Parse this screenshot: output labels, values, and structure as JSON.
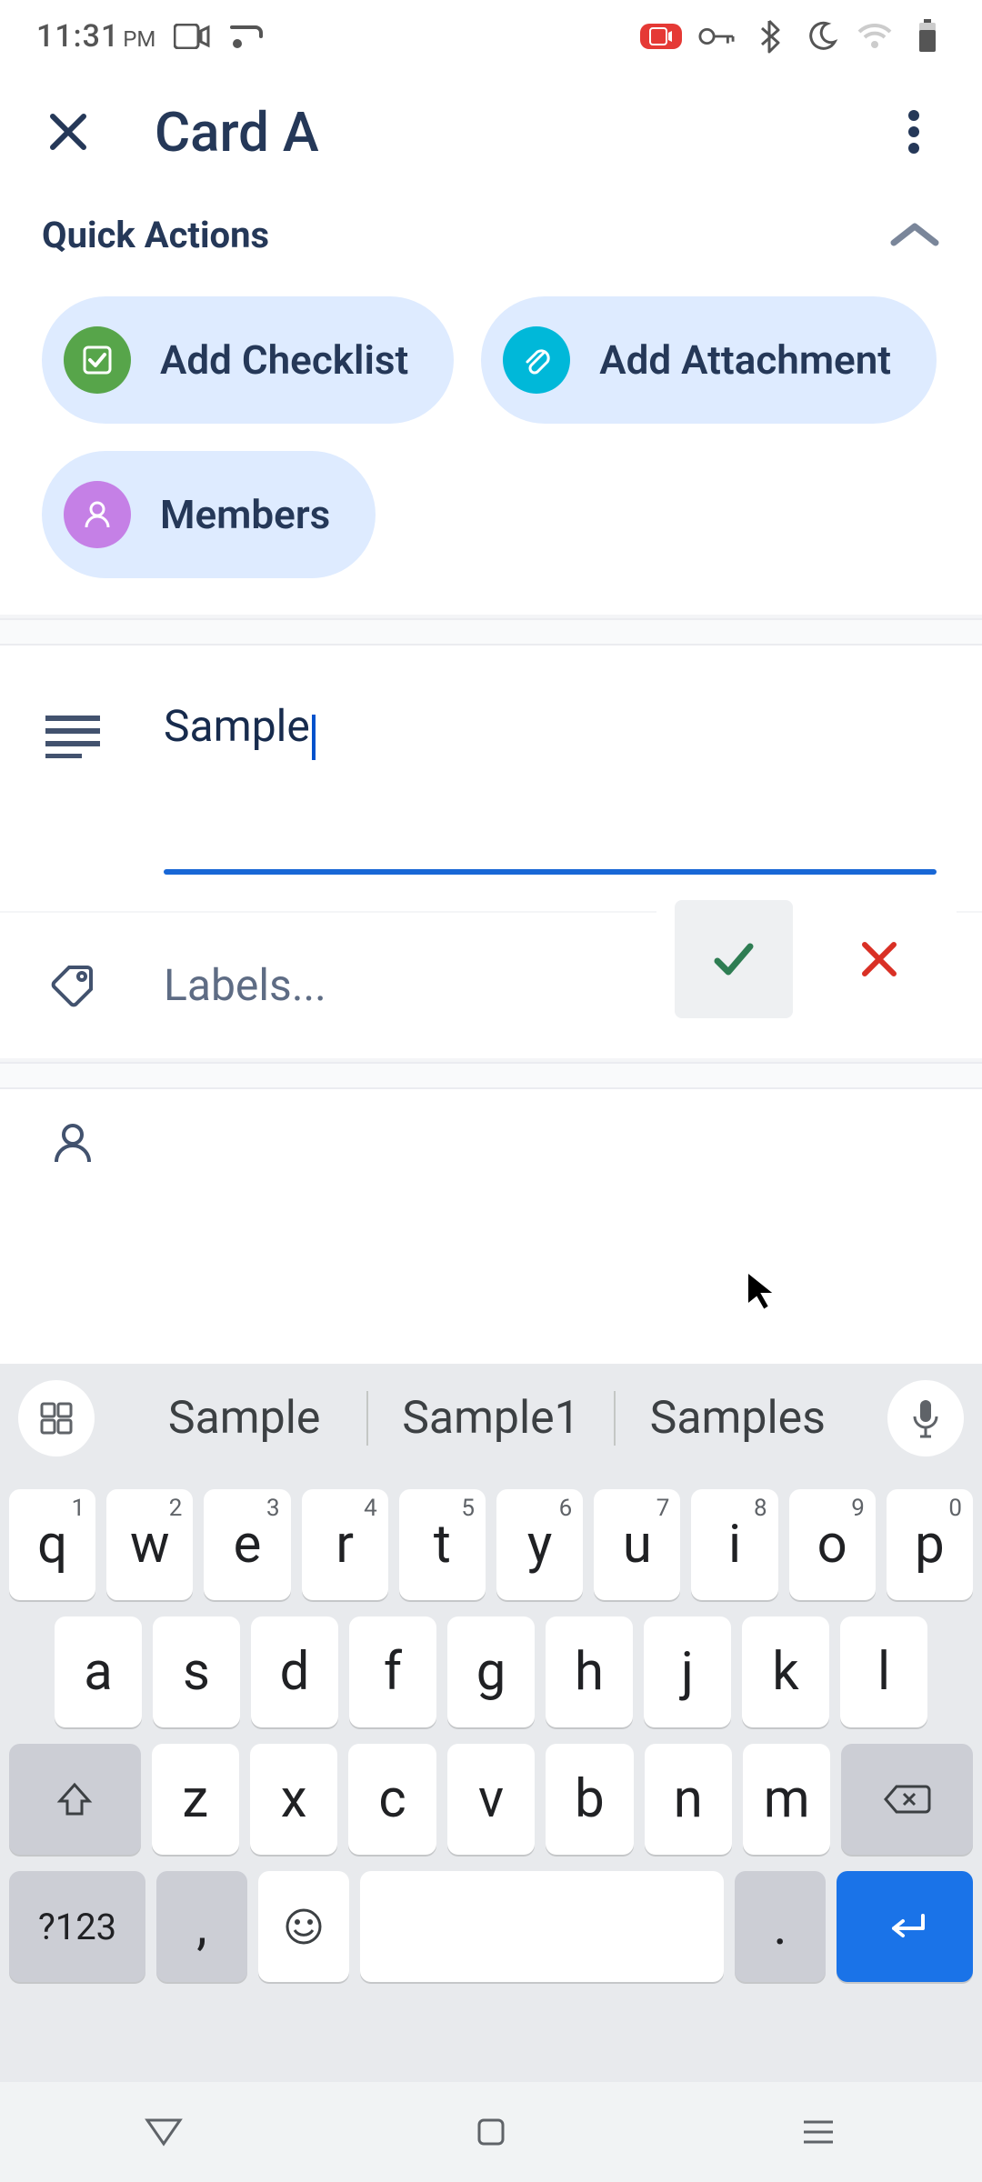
{
  "status": {
    "time": "11:31",
    "ampm": "PM"
  },
  "header": {
    "title": "Card A"
  },
  "quick_actions": {
    "title": "Quick Actions",
    "add_checklist": "Add Checklist",
    "add_attachment": "Add Attachment",
    "members": "Members"
  },
  "description": {
    "value": "Sample"
  },
  "labels": {
    "placeholder": "Labels..."
  },
  "keyboard": {
    "suggestions": [
      "Sample",
      "Sample1",
      "Samples"
    ],
    "row1": [
      {
        "k": "q",
        "h": "1"
      },
      {
        "k": "w",
        "h": "2"
      },
      {
        "k": "e",
        "h": "3"
      },
      {
        "k": "r",
        "h": "4"
      },
      {
        "k": "t",
        "h": "5"
      },
      {
        "k": "y",
        "h": "6"
      },
      {
        "k": "u",
        "h": "7"
      },
      {
        "k": "i",
        "h": "8"
      },
      {
        "k": "o",
        "h": "9"
      },
      {
        "k": "p",
        "h": "0"
      }
    ],
    "row2": [
      "a",
      "s",
      "d",
      "f",
      "g",
      "h",
      "j",
      "k",
      "l"
    ],
    "row3": [
      "z",
      "x",
      "c",
      "v",
      "b",
      "n",
      "m"
    ],
    "symbols_key": "?123",
    "comma_key": ",",
    "period_key": "."
  }
}
